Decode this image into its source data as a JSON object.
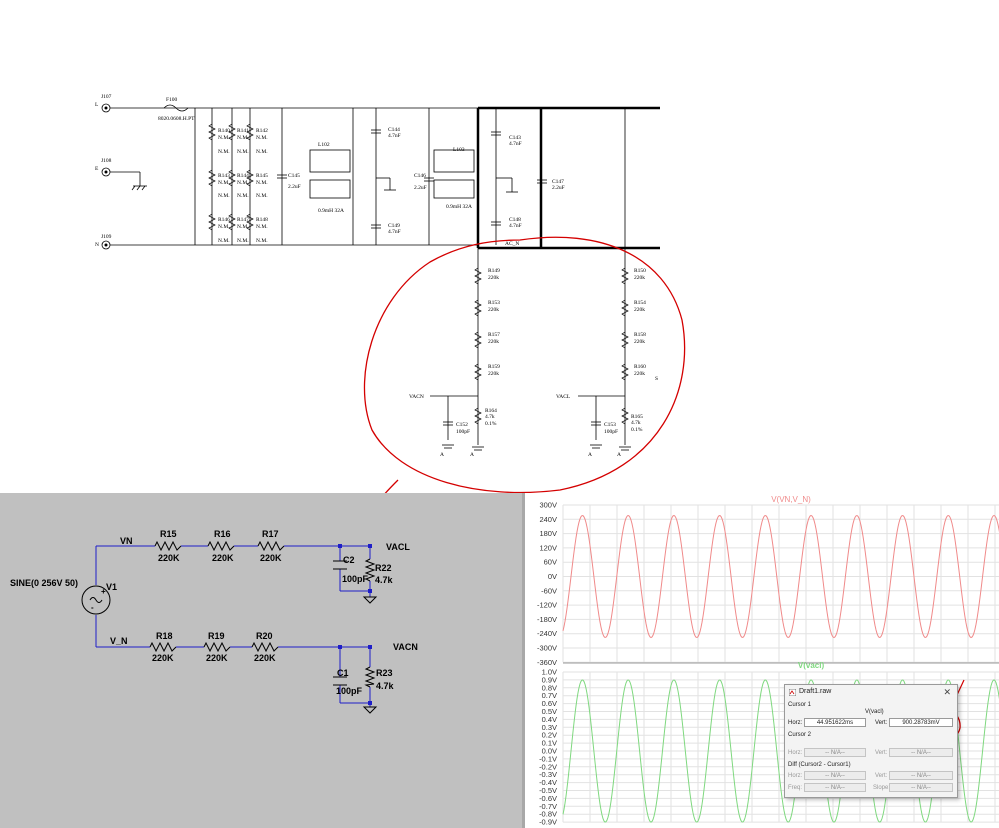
{
  "top_schematic": {
    "connectors": [
      {
        "ref": "J107",
        "pin": "L"
      },
      {
        "ref": "J108",
        "pin": "E"
      },
      {
        "ref": "J109",
        "pin": "N"
      }
    ],
    "fuse": {
      "ref": "F100",
      "value": "8020.0608.H.PT"
    },
    "resistor_labels": [
      "R140",
      "R141",
      "R142",
      "R143",
      "R144",
      "R145",
      "R146",
      "R147",
      "R148"
    ],
    "nm": "N.M.",
    "caps": [
      {
        "ref": "C145",
        "value": "2.2uF"
      },
      {
        "ref": "C144",
        "value": "4.7nF"
      },
      {
        "ref": "C146",
        "value": "2.2uF"
      },
      {
        "ref": "C149",
        "value": "4.7nF"
      },
      {
        "ref": "C143",
        "value": "4.7nF"
      },
      {
        "ref": "C147",
        "value": "2.2uF"
      },
      {
        "ref": "C148",
        "value": "4.7nF"
      }
    ],
    "chokes": [
      {
        "ref": "L102",
        "value": "0.9mH 32A"
      },
      {
        "ref": "L103",
        "value": "0.9mH 32A"
      }
    ],
    "net_acn": "AC_N",
    "left_divider": [
      {
        "ref": "R149",
        "value": "220k"
      },
      {
        "ref": "R153",
        "value": "220k"
      },
      {
        "ref": "R157",
        "value": "220k"
      },
      {
        "ref": "R159",
        "value": "220k"
      }
    ],
    "right_divider": [
      {
        "ref": "R150",
        "value": "220k"
      },
      {
        "ref": "R154",
        "value": "220k"
      },
      {
        "ref": "R158",
        "value": "220k"
      },
      {
        "ref": "R160",
        "value": "220k"
      }
    ],
    "stray_s": "S",
    "vacn": "VACN",
    "vacl": "VACL",
    "c152": {
      "ref": "C152",
      "value": "100pF"
    },
    "c153": {
      "ref": "C153",
      "value": "100pF"
    },
    "r164": {
      "ref": "R164",
      "value": "4.7k",
      "tol": "0.1%"
    },
    "r165": {
      "ref": "R165",
      "value": "4.7k",
      "tol": "0.1%"
    },
    "gnd_a": "A"
  },
  "sim_schematic": {
    "source": {
      "ref": "V1",
      "value": "SINE(0 256V 50)"
    },
    "net_vn": "VN",
    "net_v_n": "V_N",
    "top_resistors": [
      {
        "ref": "R15",
        "value": "220K"
      },
      {
        "ref": "R16",
        "value": "220K"
      },
      {
        "ref": "R17",
        "value": "220K"
      }
    ],
    "bottom_resistors": [
      {
        "ref": "R18",
        "value": "220K"
      },
      {
        "ref": "R19",
        "value": "220K"
      },
      {
        "ref": "R20",
        "value": "220K"
      }
    ],
    "vacl": "VACL",
    "vacn": "VACN",
    "c2": {
      "ref": "C2",
      "value": "100pF"
    },
    "c1": {
      "ref": "C1",
      "value": "100pF"
    },
    "r22": {
      "ref": "R22",
      "value": "4.7k"
    },
    "r23": {
      "ref": "R23",
      "value": "4.7k"
    }
  },
  "waveforms": {
    "pane1": {
      "title": "V(VN,V_N)",
      "color": "#f08a8a",
      "ticks": [
        "300V",
        "240V",
        "180V",
        "120V",
        "60V",
        "0V",
        "-60V",
        "-120V",
        "-180V",
        "-240V",
        "-300V",
        "-360V"
      ],
      "amplitude": 256,
      "ylim": [
        -360,
        300
      ]
    },
    "pane2": {
      "title": "V(vacl)",
      "color": "#7fd87f",
      "ticks": [
        "1.0V",
        "0.9V",
        "0.8V",
        "0.7V",
        "0.6V",
        "0.5V",
        "0.4V",
        "0.3V",
        "0.2V",
        "0.1V",
        "0.0V",
        "-0.1V",
        "-0.2V",
        "-0.3V",
        "-0.4V",
        "-0.5V",
        "-0.6V",
        "-0.7V",
        "-0.8V",
        "-0.9V"
      ],
      "amplitude": 0.9,
      "ylim": [
        -0.9,
        1.0
      ]
    }
  },
  "cursor_dialog": {
    "title": "Draft1.raw",
    "cursor1": "Cursor 1",
    "trace": "V(vacl)",
    "horz_label": "Horz:",
    "horz_value": "44.951622ms",
    "vert_label": "Vert:",
    "vert_value": "900.28783mV",
    "cursor2": "Cursor 2",
    "na": "-- N/A--",
    "diff": "Diff (Cursor2 - Cursor1)",
    "freq_label": "Freq:",
    "slope_label": "Slope:"
  },
  "colors": {
    "annotation_red": "#d40000",
    "ltspice_wire": "#1e1ec8",
    "ltspice_bg": "#c0c0c0"
  }
}
